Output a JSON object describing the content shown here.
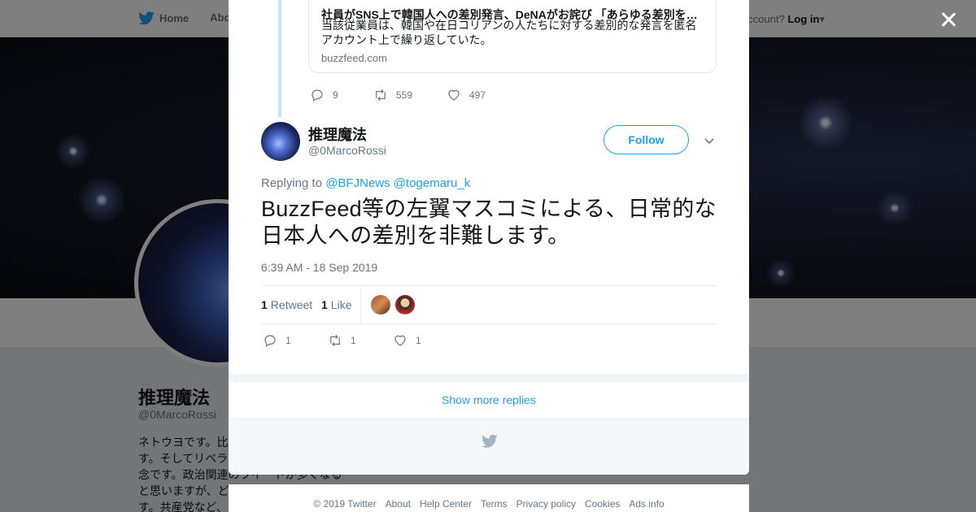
{
  "topbar": {
    "nav": [
      {
        "label": "Home"
      },
      {
        "label": "Abo"
      }
    ],
    "account_prompt": "ccount?",
    "login_label": "Log in"
  },
  "profile": {
    "name": "推理魔法",
    "handle": "@0MarcoRossi",
    "bio_lines": [
      "ネトウヨです。比",
      "す。そしてリベラ",
      "念です。政治関連のツイートが多くなる",
      "と思いますが、ど",
      "す。共産党など、"
    ]
  },
  "parent_tweet": {
    "card": {
      "title": "社員がSNS上で韓国人への差別発言、DeNAがお詫び 「あらゆる差別を…",
      "description": "当該従業員は、韓国や在日コリアンの人たちに対する差別的な発言を匿名アカウント上で繰り返していた。",
      "domain": "buzzfeed.com"
    },
    "actions": {
      "replies": "9",
      "retweets": "559",
      "likes": "497"
    }
  },
  "tweet": {
    "name": "推理魔法",
    "handle": "@0MarcoRossi",
    "follow_label": "Follow",
    "replying_prefix": "Replying to",
    "replying_to": [
      "@BFJNews",
      "@togemaru_k"
    ],
    "text": "BuzzFeed等の左翼マスコミによる、日常的な日本人への差別を非難します。",
    "timestamp": "6:39 AM - 18 Sep 2019",
    "stats": {
      "retweets_count": "1",
      "retweets_label": "Retweet",
      "likes_count": "1",
      "likes_label": "Like"
    },
    "actions": {
      "replies": "1",
      "retweets": "1",
      "likes": "1"
    }
  },
  "show_more_label": "Show more replies",
  "footer": {
    "links": [
      "© 2019 Twitter",
      "About",
      "Help Center",
      "Terms",
      "Privacy policy",
      "Cookies",
      "Ads info"
    ]
  },
  "colors": {
    "accent": "#1da1f2",
    "text": "#14171a",
    "muted": "#657786"
  }
}
